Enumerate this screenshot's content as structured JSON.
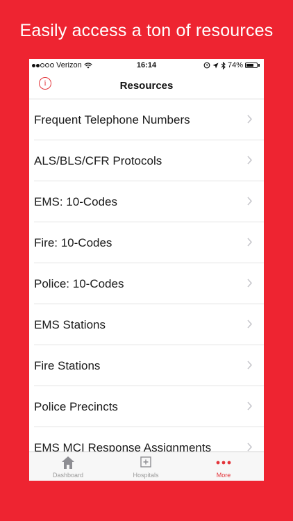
{
  "promo": {
    "text": "Easily access a ton of resources"
  },
  "status": {
    "carrier": "Verizon",
    "time": "16:14",
    "battery": "74%",
    "battery_level": 0.74
  },
  "nav": {
    "title": "Resources",
    "info_icon": "info-icon",
    "accent": "#e3343a"
  },
  "list": {
    "items": [
      {
        "label": "Frequent Telephone Numbers"
      },
      {
        "label": "ALS/BLS/CFR Protocols"
      },
      {
        "label": "EMS: 10-Codes"
      },
      {
        "label": "Fire: 10-Codes"
      },
      {
        "label": "Police: 10-Codes"
      },
      {
        "label": "EMS Stations"
      },
      {
        "label": "Fire Stations"
      },
      {
        "label": "Police Precincts"
      },
      {
        "label": "EMS MCI Response Assignments"
      }
    ]
  },
  "tabs": [
    {
      "label": "Dashboard",
      "icon": "house-icon"
    },
    {
      "label": "Hospitals",
      "icon": "hospital-plus-icon"
    },
    {
      "label": "More",
      "icon": "more-dots-icon",
      "active": true
    }
  ],
  "colors": {
    "background": "#ee2431",
    "accent": "#e3343a"
  }
}
